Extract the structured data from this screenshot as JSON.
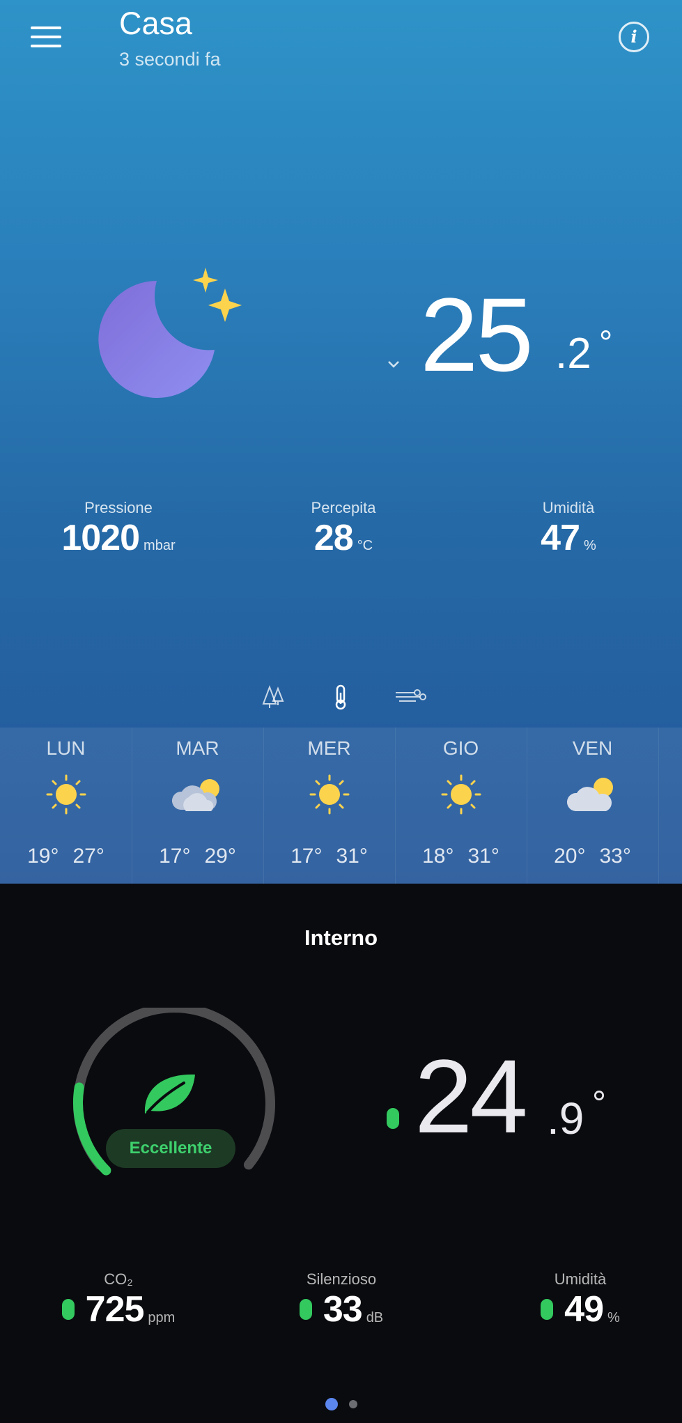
{
  "header": {
    "title": "Casa",
    "subtitle": "3 secondi fa",
    "menu_icon": "menu-icon",
    "info_icon": "info-icon",
    "info_glyph": "i"
  },
  "outdoor": {
    "condition_icon": "moon-stars-icon",
    "temp_int": "25",
    "temp_dec": ".2",
    "temp_deg": "°",
    "stats": [
      {
        "label": "Pressione",
        "value": "1020",
        "unit": "mbar"
      },
      {
        "label": "Percepita",
        "value": "28",
        "unit": "°C"
      },
      {
        "label": "Umidità",
        "value": "47",
        "unit": "%"
      }
    ],
    "modes": [
      "pollen-icon",
      "thermometer-icon",
      "wind-icon"
    ]
  },
  "forecast": [
    {
      "day": "LUN",
      "icon": "sun-icon",
      "min": "19°",
      "max": "27°"
    },
    {
      "day": "MAR",
      "icon": "cloud-sun-icon",
      "min": "17°",
      "max": "29°"
    },
    {
      "day": "MER",
      "icon": "sun-icon",
      "min": "17°",
      "max": "31°"
    },
    {
      "day": "GIO",
      "icon": "sun-icon",
      "min": "18°",
      "max": "31°"
    },
    {
      "day": "VEN",
      "icon": "cloud-sun-icon",
      "min": "20°",
      "max": "33°"
    }
  ],
  "indoor": {
    "title": "Interno",
    "quality_label": "Eccellente",
    "quality_level": 0.2,
    "temp_int": "24",
    "temp_dec": ".9",
    "temp_deg": "°",
    "stats": [
      {
        "label": "CO₂",
        "value": "725",
        "unit": "ppm"
      },
      {
        "label": "Silenzioso",
        "value": "33",
        "unit": "dB"
      },
      {
        "label": "Umidità",
        "value": "49",
        "unit": "%"
      }
    ]
  },
  "pager": {
    "pages": 2,
    "active": 1
  },
  "colors": {
    "sun": "#fcd34d",
    "moon": "#8a86e6",
    "good": "#33c95f",
    "pager_active": "#5b86ee"
  }
}
